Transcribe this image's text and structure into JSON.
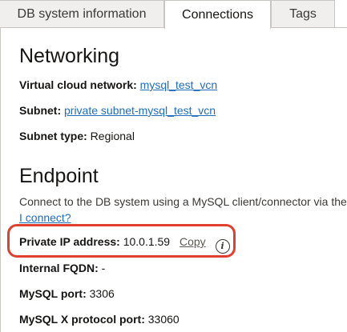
{
  "tabs": [
    {
      "label": "DB system information"
    },
    {
      "label": "Connections"
    },
    {
      "label": "Tags"
    }
  ],
  "networking": {
    "title": "Networking",
    "vcn_label": "Virtual cloud network:",
    "vcn_value": "mysql_test_vcn",
    "subnet_label": "Subnet:",
    "subnet_value": "private subnet-mysql_test_vcn",
    "subnet_type_label": "Subnet type:",
    "subnet_type_value": "Regional"
  },
  "endpoint": {
    "title": "Endpoint",
    "description": "Connect to the DB system using a MySQL client/connector via the",
    "how_link": "I connect?",
    "private_ip_label": "Private IP address:",
    "private_ip_value": "10.0.1.59",
    "copy_label": "Copy",
    "fqdn_label": "Internal FQDN:",
    "fqdn_value": "-",
    "mysql_port_label": "MySQL port:",
    "mysql_port_value": "3306",
    "x_port_label": "MySQL X protocol port:",
    "x_port_value": "33060"
  },
  "colors": {
    "link": "#206dbc",
    "highlight": "#e2402f"
  },
  "icons": {
    "info": "info-icon"
  }
}
